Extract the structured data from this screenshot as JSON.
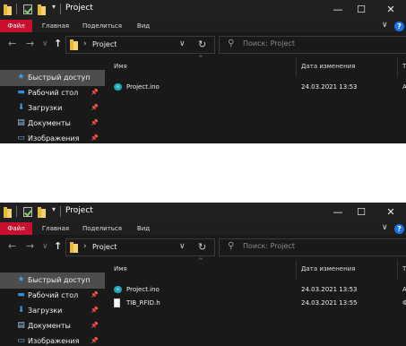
{
  "window_title": "Project",
  "titlebar": {
    "minimize": "—",
    "maximize": "☐",
    "close": "✕",
    "qat_dropdown": "▾"
  },
  "ribbon": {
    "tabs": [
      "Файл",
      "Главная",
      "Поделиться",
      "Вид"
    ],
    "expand": "∨",
    "help": "?"
  },
  "nav": {
    "back": "←",
    "forward": "→",
    "recent": "∨",
    "up": "↑",
    "chevron": "›",
    "dropdown": "∨",
    "refresh": "↻"
  },
  "address": {
    "path": "Project"
  },
  "search": {
    "placeholder": "Поиск: Project",
    "icon": "⚲"
  },
  "sidebar": {
    "items": [
      {
        "label": "Быстрый доступ",
        "icon": "★",
        "pin": ""
      },
      {
        "label": "Рабочий стол",
        "icon": "▬",
        "pin": "📌"
      },
      {
        "label": "Загрузки",
        "icon": "⬇",
        "pin": "📌"
      },
      {
        "label": "Документы",
        "icon": "▤",
        "pin": "📌"
      },
      {
        "label": "Изображения",
        "icon": "▭",
        "pin": "📌"
      }
    ]
  },
  "columns": {
    "name": "Имя",
    "date": "Дата изменения",
    "type": "Т",
    "sort_caret": "^"
  },
  "window1": {
    "files": [
      {
        "name": "Project.ino",
        "date": "24.03.2021 13:53",
        "type": "А"
      }
    ]
  },
  "window2": {
    "files": [
      {
        "name": "Project.ino",
        "date": "24.03.2021 13:53",
        "type": "А"
      },
      {
        "name": "TIB_RFID.h",
        "date": "24.03.2021 13:55",
        "type": "Ф"
      }
    ]
  },
  "colors": {
    "file_tab": "#c8102e",
    "help": "#1a73e8",
    "ino_icon": "#1da8b7",
    "folder": "#e8b83a"
  }
}
